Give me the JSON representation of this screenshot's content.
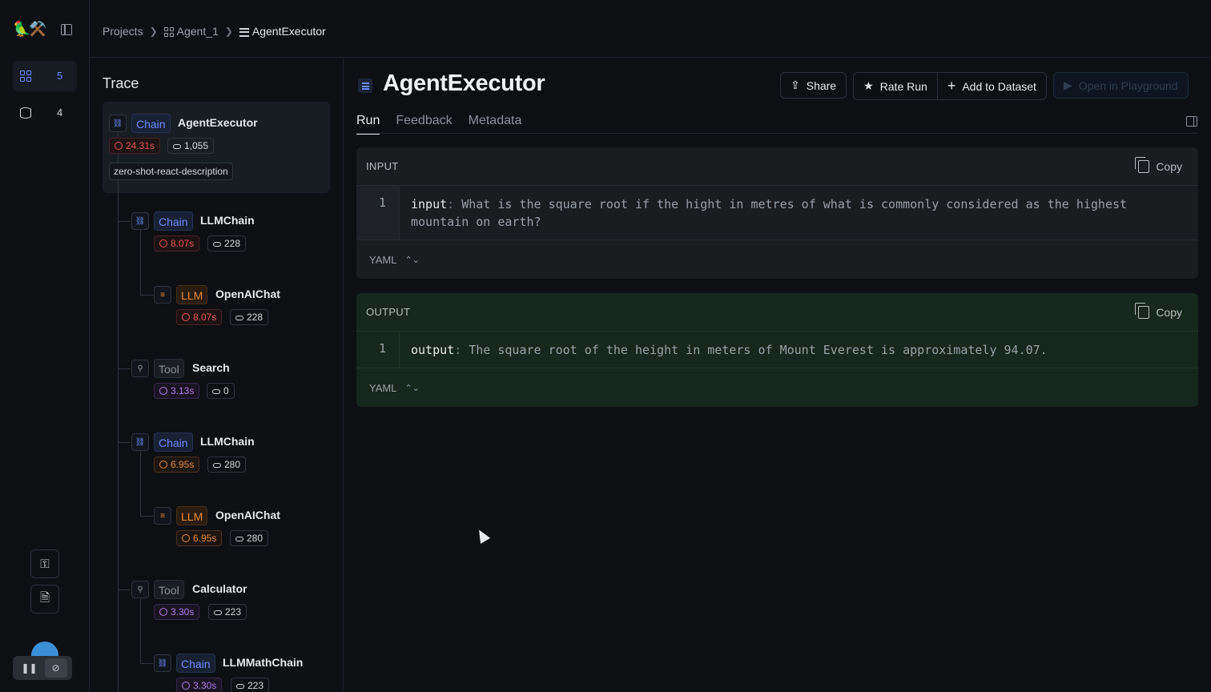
{
  "app": {
    "logo": "🦜⚒️"
  },
  "rail": {
    "items": [
      {
        "icon": "projects-grid-icon",
        "count": "5"
      },
      {
        "icon": "database-icon",
        "count": "4"
      }
    ]
  },
  "breadcrumb": {
    "projects": "Projects",
    "project": "Agent_1",
    "run": "AgentExecutor"
  },
  "trace": {
    "title": "Trace",
    "nodes": [
      {
        "type": "Chain",
        "name": "AgentExecutor",
        "time": "24.31s",
        "tokens": "1,055",
        "tag": "zero-shot-react-description",
        "time_color": "red"
      },
      {
        "type": "Chain",
        "name": "LLMChain",
        "time": "8.07s",
        "tokens": "228",
        "time_color": "red"
      },
      {
        "type": "LLM",
        "name": "OpenAIChat",
        "time": "8.07s",
        "tokens": "228",
        "time_color": "red"
      },
      {
        "type": "Tool",
        "name": "Search",
        "time": "3.13s",
        "tokens": "0",
        "time_color": "purple"
      },
      {
        "type": "Chain",
        "name": "LLMChain",
        "time": "6.95s",
        "tokens": "280",
        "time_color": "orange"
      },
      {
        "type": "LLM",
        "name": "OpenAIChat",
        "time": "6.95s",
        "tokens": "280",
        "time_color": "orange"
      },
      {
        "type": "Tool",
        "name": "Calculator",
        "time": "3.30s",
        "tokens": "223",
        "time_color": "purple"
      },
      {
        "type": "Chain",
        "name": "LLMMathChain",
        "time": "3.30s",
        "tokens": "223",
        "time_color": "purple"
      }
    ]
  },
  "header": {
    "title": "AgentExecutor",
    "share": "Share",
    "rate": "Rate Run",
    "add_dataset": "Add to Dataset",
    "playground": "Open in Playground"
  },
  "tabs": [
    "Run",
    "Feedback",
    "Metadata"
  ],
  "input": {
    "label": "INPUT",
    "copy": "Copy",
    "line": "1",
    "key": "input",
    "sep": ":",
    "value": "What is the square root if the hight in metres of what is commonly considered as the highest mountain on earth?",
    "format": "YAML"
  },
  "output": {
    "label": "OUTPUT",
    "copy": "Copy",
    "line": "1",
    "key": "output",
    "sep": ":",
    "value": "The square root of the height in meters of Mount Everest is approximately 94.07.",
    "format": "YAML"
  },
  "colors": {
    "chain": "#6b8cff",
    "llm": "#e58a3a",
    "tool": "#8a8f98",
    "output_bg": "#16271d"
  }
}
